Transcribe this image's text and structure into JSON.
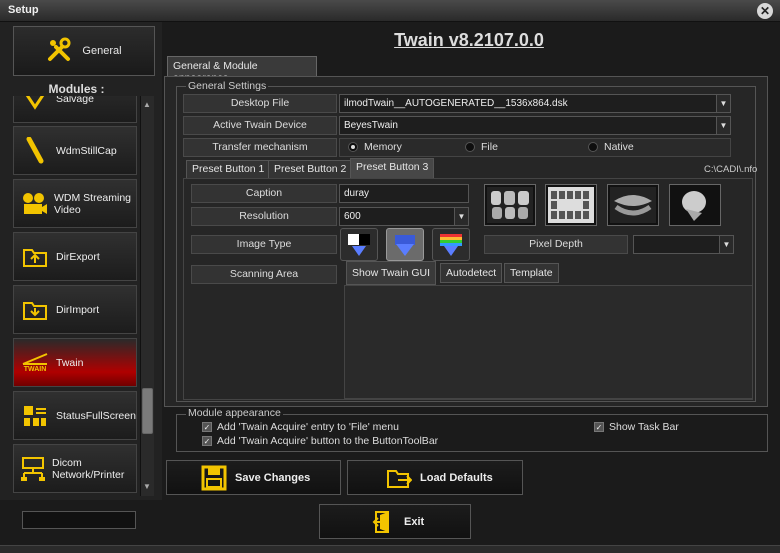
{
  "window": {
    "title": "Setup"
  },
  "version": "Twain v8.2107.0.0",
  "left": {
    "general_label": "General",
    "modules_label": "Modules :",
    "modules": [
      {
        "label": "Salvage",
        "icon": "tool-icon"
      },
      {
        "label": "WdmStillCap",
        "icon": "usb-cable-icon"
      },
      {
        "label": "WDM Streaming Video",
        "icon": "film-camera-icon"
      },
      {
        "label": "DirExport",
        "icon": "folder-export-icon"
      },
      {
        "label": "DirImport",
        "icon": "folder-import-icon"
      },
      {
        "label": "Twain",
        "icon": "twain-icon",
        "sublabel": "TWAIN"
      },
      {
        "label": "StatusFullScreen",
        "icon": "status-grid-icon"
      },
      {
        "label": "Dicom Network/Printer",
        "icon": "network-icon"
      }
    ]
  },
  "main_tab": "General & Module appearance",
  "general": {
    "legend": "General Settings",
    "desktop_file_label": "Desktop File",
    "desktop_file_value": "ilmodTwain__AUTOGENERATED__1536x864.dsk",
    "device_label": "Active Twain Device",
    "device_value": "BeyesTwain",
    "transfer_label": "Transfer mechanism",
    "transfer_options": [
      "Memory",
      "File",
      "Native"
    ],
    "transfer_selected": "Memory"
  },
  "preset_tabs": [
    "Preset Button 1",
    "Preset Button 2",
    "Preset Button 3"
  ],
  "path": "C:\\CADI\\.nfo",
  "preset": {
    "caption_label": "Caption",
    "caption_value": "duray",
    "resolution_label": "Resolution",
    "resolution_value": "600",
    "image_type_label": "Image Type",
    "pixel_depth_label": "Pixel Depth",
    "pixel_depth_value": "",
    "scanning_area_label": "Scanning Area",
    "sub_tabs": [
      "Show Twain GUI",
      "Autodetect",
      "Template"
    ]
  },
  "module_appearance": {
    "legend": "Module appearance",
    "cb1": "Add 'Twain Acquire' entry to 'File' menu",
    "cb2": "Add 'Twain Acquire' button to the ButtonToolBar",
    "cb3": "Show Task Bar"
  },
  "buttons": {
    "save": "Save Changes",
    "load": "Load Defaults",
    "exit": "Exit"
  }
}
